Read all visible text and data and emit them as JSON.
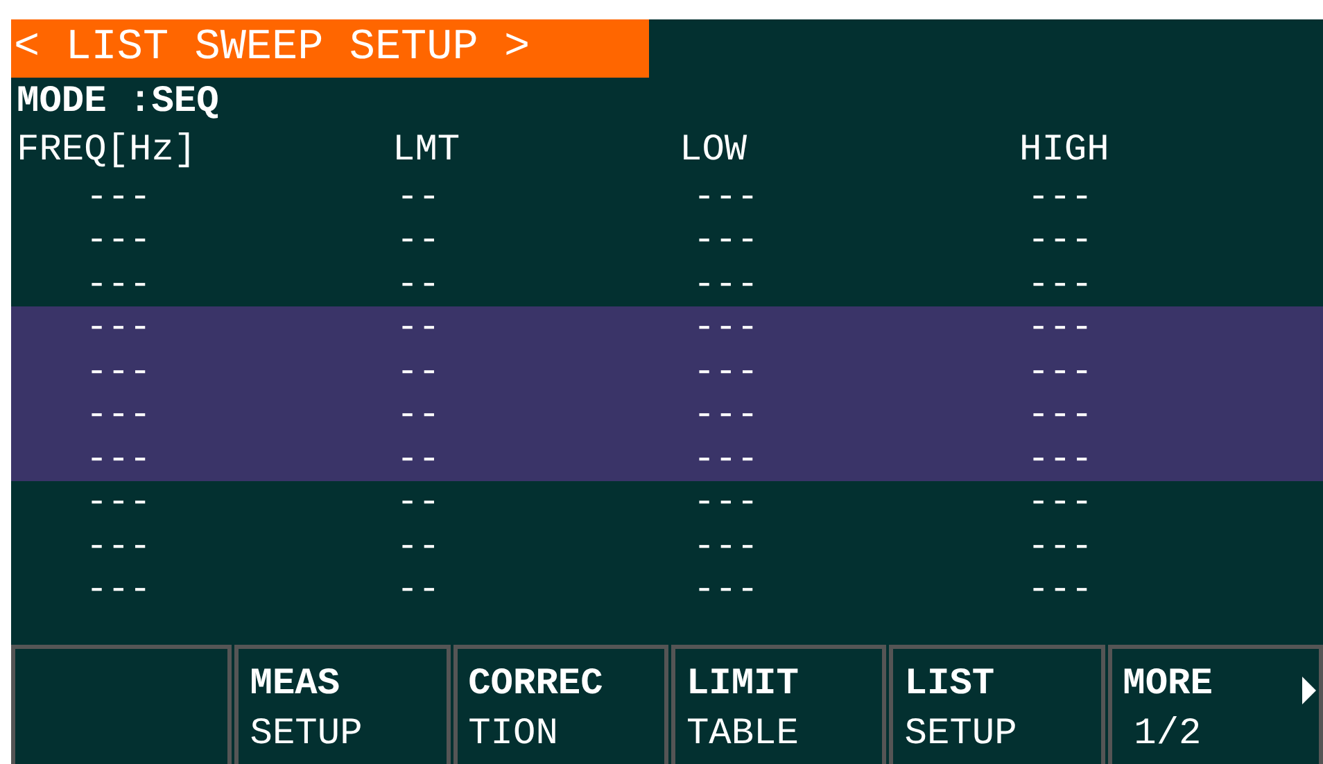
{
  "title": "< LIST SWEEP SETUP >",
  "mode": "MODE :SEQ",
  "table": {
    "columns": [
      "FREQ[Hz]",
      "LMT",
      "LOW",
      "HIGH"
    ],
    "rows": [
      {
        "cells": [
          "---",
          "--",
          "---",
          "---"
        ],
        "selected": false
      },
      {
        "cells": [
          "---",
          "--",
          "---",
          "---"
        ],
        "selected": false
      },
      {
        "cells": [
          "---",
          "--",
          "---",
          "---"
        ],
        "selected": false
      },
      {
        "cells": [
          "---",
          "--",
          "---",
          "---"
        ],
        "selected": true
      },
      {
        "cells": [
          "---",
          "--",
          "---",
          "---"
        ],
        "selected": true
      },
      {
        "cells": [
          "---",
          "--",
          "---",
          "---"
        ],
        "selected": true
      },
      {
        "cells": [
          "---",
          "--",
          "---",
          "---"
        ],
        "selected": true
      },
      {
        "cells": [
          "---",
          "--",
          "---",
          "---"
        ],
        "selected": false
      },
      {
        "cells": [
          "---",
          "--",
          "---",
          "---"
        ],
        "selected": false
      },
      {
        "cells": [
          "---",
          "--",
          "---",
          "---"
        ],
        "selected": false
      }
    ]
  },
  "softkeys": [
    {
      "kind": "blank"
    },
    {
      "lines": [
        "MEAS",
        "SETUP"
      ]
    },
    {
      "lines": [
        "CORREC",
        "TION"
      ]
    },
    {
      "lines": [
        "LIMIT",
        "TABLE"
      ]
    },
    {
      "lines": [
        "LIST",
        "SETUP"
      ]
    },
    {
      "lines": [
        "MORE",
        "1/2"
      ],
      "kind": "more"
    }
  ]
}
